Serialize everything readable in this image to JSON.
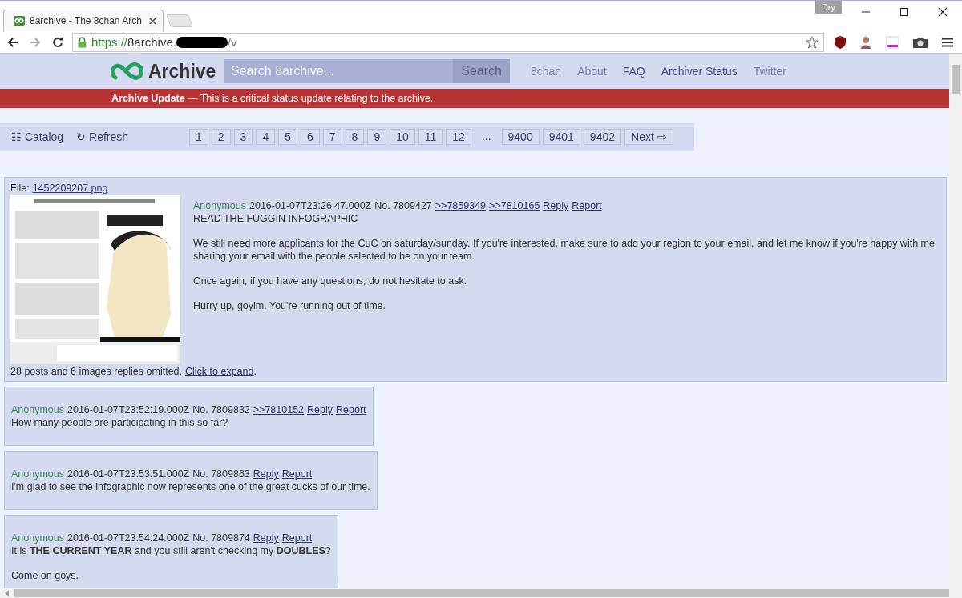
{
  "browser": {
    "tab_title": "8archive - The 8chan Arch",
    "profile_badge": "Dry",
    "url": {
      "scheme": "https://",
      "host": "8archive.",
      "redacted": true,
      "path": "/v"
    }
  },
  "header": {
    "logo_text": "Archive",
    "search": {
      "placeholder": "Search 8archive...",
      "button": "Search"
    },
    "nav": [
      {
        "label": "8chan",
        "highlighted": false
      },
      {
        "label": "About",
        "highlighted": false
      },
      {
        "label": "FAQ",
        "highlighted": true
      },
      {
        "label": "Archiver Status",
        "highlighted": true
      },
      {
        "label": "Twitter",
        "highlighted": false
      }
    ]
  },
  "banner": {
    "title": "Archive Update",
    "text": " — This is a critical status update relating to the archive."
  },
  "toolbar": {
    "actions": [
      {
        "icon": "☷",
        "label": "Catalog"
      },
      {
        "icon": "↻",
        "label": "Refresh"
      }
    ],
    "pages": [
      {
        "label": "1",
        "kind": "page"
      },
      {
        "label": "2",
        "kind": "page"
      },
      {
        "label": "3",
        "kind": "page"
      },
      {
        "label": "4",
        "kind": "page"
      },
      {
        "label": "5",
        "kind": "page"
      },
      {
        "label": "6",
        "kind": "page"
      },
      {
        "label": "7",
        "kind": "page"
      },
      {
        "label": "8",
        "kind": "page"
      },
      {
        "label": "9",
        "kind": "page"
      },
      {
        "label": "10",
        "kind": "page"
      },
      {
        "label": "11",
        "kind": "page"
      },
      {
        "label": "12",
        "kind": "page"
      },
      {
        "label": "...",
        "kind": "gap"
      },
      {
        "label": "9400",
        "kind": "page"
      },
      {
        "label": "9401",
        "kind": "page"
      },
      {
        "label": "9402",
        "kind": "page"
      },
      {
        "label": "Next ⇨",
        "kind": "page"
      }
    ]
  },
  "thread": {
    "op": {
      "file_label": "File:",
      "file_name": "1452209207.png",
      "thumbnail": {
        "kind": "picture"
      },
      "name": "Anonymous",
      "date": "2016-01-07T23:26:47.000Z",
      "number": "No. 7809427",
      "backlinks": [
        ">>7859349",
        ">>7810165"
      ],
      "actions": [
        "Reply",
        "Report"
      ],
      "body": [
        "READ THE FUGGIN INFOGRAPHIC",
        "We still need more applicants for the CuC on saturday/sunday. If you're interested, make sure to add your region to your email, and let me know if you're happy with me sharing your email with the people selected to be on your team.",
        "Once again, if you have any questions, do not hesitate to ask.",
        "Hurry up, goyim. You're running out of time."
      ],
      "omitted": "28 posts and 6 images replies omitted.",
      "expand": "Click to expand",
      "expand_suffix": "."
    },
    "replies": [
      {
        "name": "Anonymous",
        "date": "2016-01-07T23:52:19.000Z",
        "number": "No. 7809832",
        "backlinks": [
          ">>7810152"
        ],
        "actions": [
          "Reply",
          "Report"
        ],
        "body": [
          "How many people are participating in this so far?"
        ]
      },
      {
        "name": "Anonymous",
        "date": "2016-01-07T23:53:51.000Z",
        "number": "No. 7809863",
        "actions": [
          "Reply",
          "Report"
        ],
        "body": [
          "I'm glad to see the infographic now represents one of the great cucks of our time."
        ]
      },
      {
        "name": "Anonymous",
        "date": "2016-01-07T23:54:24.000Z",
        "number": "No. 7809874",
        "actions": [
          "Reply",
          "Report"
        ],
        "body": [
          "It is **THE CURRENT YEAR** and you still aren't checking my **DOUBLES**?",
          "Come on goys."
        ]
      }
    ]
  }
}
